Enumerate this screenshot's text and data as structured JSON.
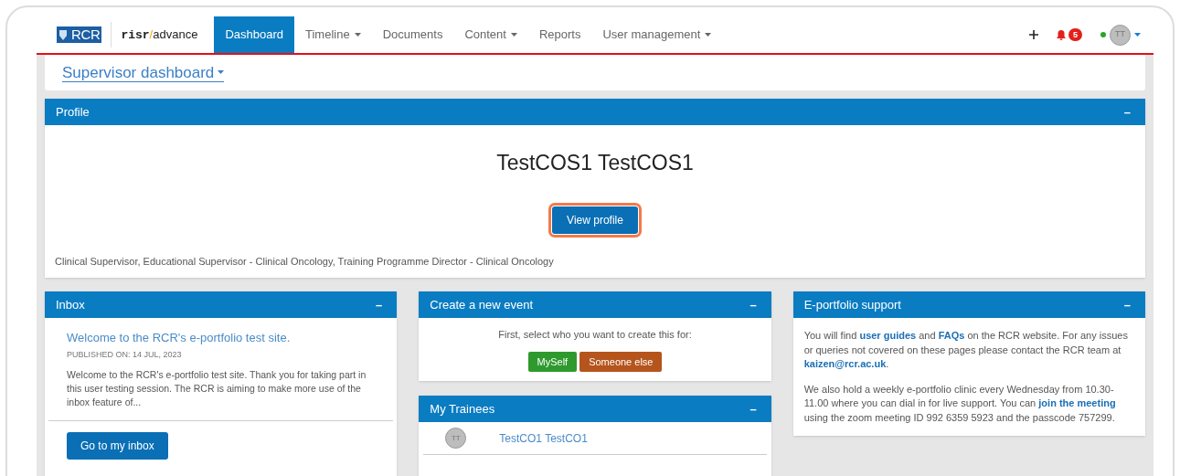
{
  "brand": {
    "mark": "RCR",
    "product_bold": "risr",
    "slash": "/",
    "product": "advance"
  },
  "nav": [
    {
      "label": "Dashboard",
      "selected": true,
      "dropdown": false
    },
    {
      "label": "Timeline",
      "selected": false,
      "dropdown": true
    },
    {
      "label": "Documents",
      "selected": false,
      "dropdown": false
    },
    {
      "label": "Content",
      "selected": false,
      "dropdown": true
    },
    {
      "label": "Reports",
      "selected": false,
      "dropdown": false
    },
    {
      "label": "User management",
      "selected": false,
      "dropdown": true
    }
  ],
  "notifications": {
    "count": "5"
  },
  "user": {
    "initials": "TT",
    "online": true
  },
  "dashboard_switch": {
    "label": "Supervisor dashboard",
    "dropdown": true
  },
  "profile": {
    "title": "Profile",
    "collapse": "–",
    "name": "TestCOS1 TestCOS1",
    "button": "View profile",
    "roles": "Clinical Supervisor, Educational Supervisor - Clinical Oncology, Training Programme Director - Clinical Oncology"
  },
  "inbox": {
    "title": "Inbox",
    "collapse": "–",
    "message_title": "Welcome to the RCR's e-portfolio test site.",
    "published": "PUBLISHED ON: 14 JUL, 2023",
    "excerpt": "Welcome to the RCR's e-portfolio test site. Thank you for taking part in this user testing session. The RCR is aiming to make more use of the inbox feature of...",
    "button": "Go to my inbox"
  },
  "event": {
    "title": "Create a new event",
    "collapse": "–",
    "prompt": "First, select who you want to create this for:",
    "buttons": [
      {
        "label": "MySelf",
        "color": "#2e9a2e"
      },
      {
        "label": "Someone else",
        "color": "#b5541c"
      }
    ]
  },
  "trainees": {
    "title": "My Trainees",
    "collapse": "–",
    "items": [
      {
        "initials": "TT",
        "name": "TestCO1 TestCO1"
      }
    ]
  },
  "support": {
    "title": "E-portfolio support",
    "collapse": "–",
    "paragraphs": [
      [
        {
          "text": "You will find ",
          "link": false
        },
        {
          "text": "user guides",
          "link": true
        },
        {
          "text": " and ",
          "link": false
        },
        {
          "text": "FAQs",
          "link": true
        },
        {
          "text": " on the RCR website. For any issues or queries not covered on these pages please contact the RCR team at ",
          "link": false
        },
        {
          "text": "kaizen@rcr.ac.uk",
          "link": true
        },
        {
          "text": ".",
          "link": false
        }
      ],
      [
        {
          "text": "We also hold a weekly e-portfolio clinic every Wednesday from 10.30-11.00 where you can dial in for live support. You can ",
          "link": false
        },
        {
          "text": "join the meeting",
          "link": true
        },
        {
          "text": " using the zoom meeting ID 992 6359 5923 and the passcode 757299.",
          "link": false
        }
      ]
    ]
  }
}
